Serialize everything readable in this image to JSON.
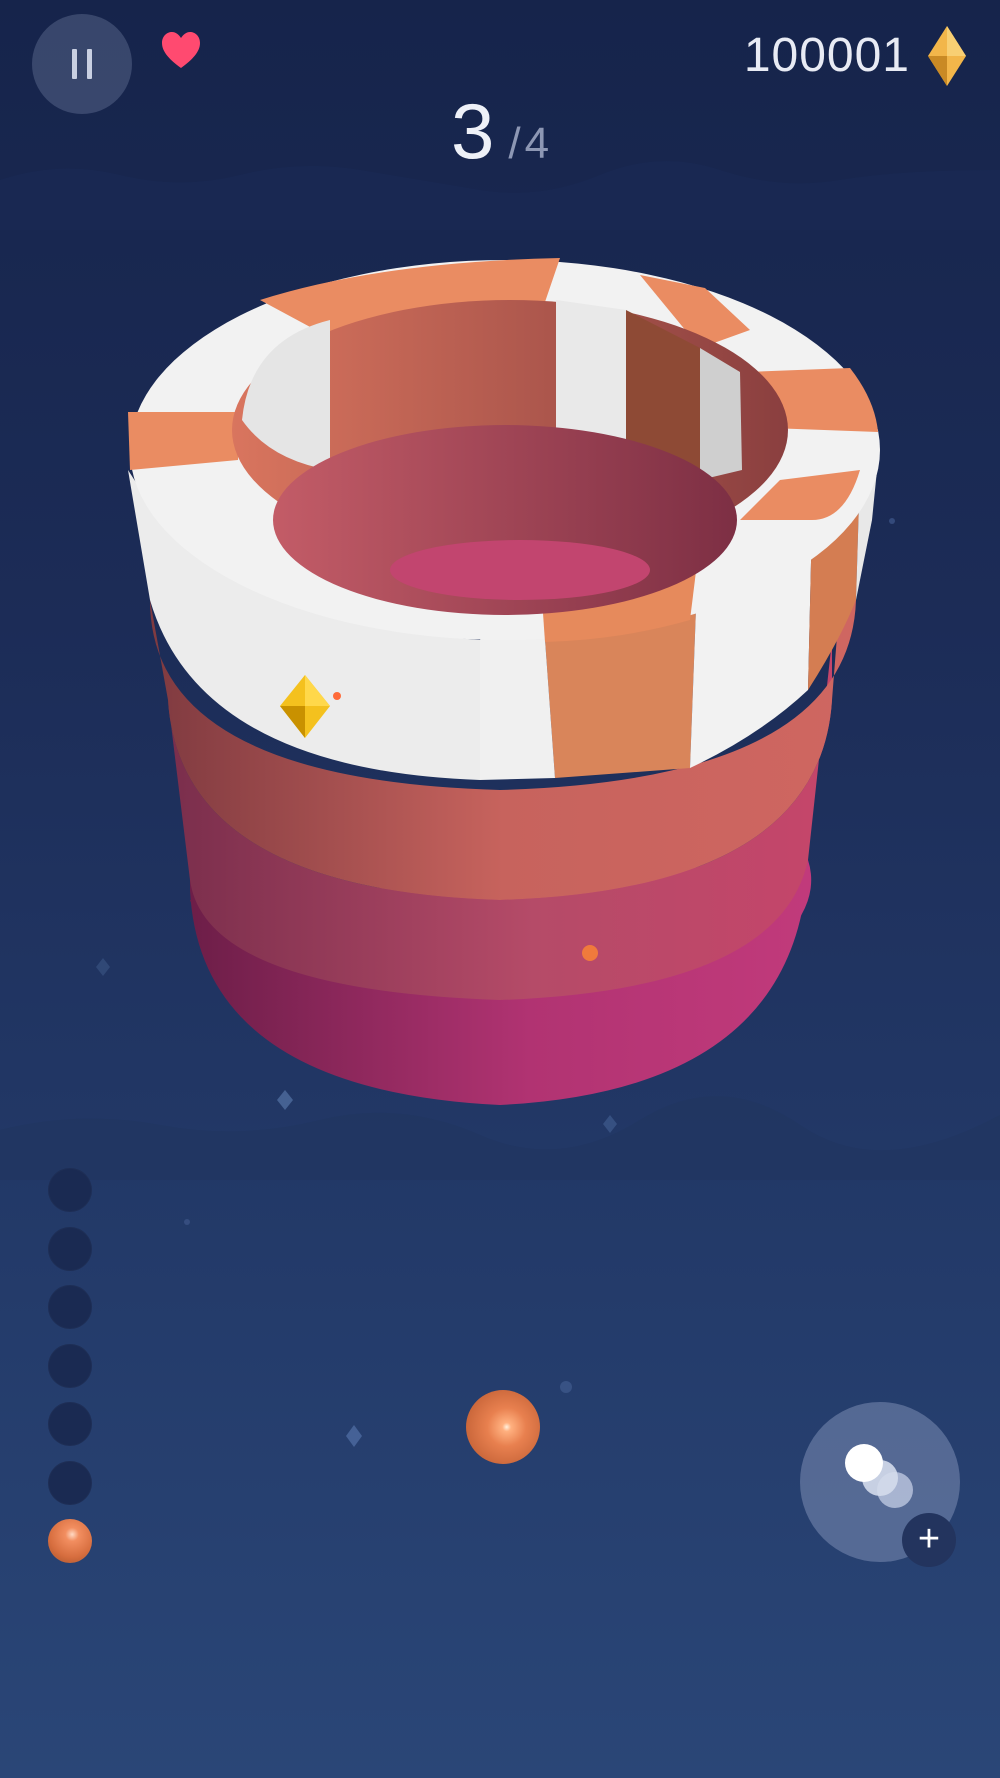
{
  "hud": {
    "gems": "100001",
    "level_current": "3",
    "level_separator": "/",
    "level_total": "4"
  },
  "ball_queue": {
    "empty_slots": 6,
    "active_color": "#e57d4b"
  },
  "colors": {
    "background_top": "#16244b",
    "background_bottom": "#2a4677",
    "orange": "#e98a5f",
    "white_segment": "#f4f4f4",
    "pink": "#c13777",
    "gem_gold": "#f1c232",
    "heart": "#ff4a70"
  },
  "icons": {
    "pause": "pause-icon",
    "heart": "heart-icon",
    "gem": "diamond-icon",
    "powerup": "multi-ball-icon",
    "add": "plus-icon"
  }
}
